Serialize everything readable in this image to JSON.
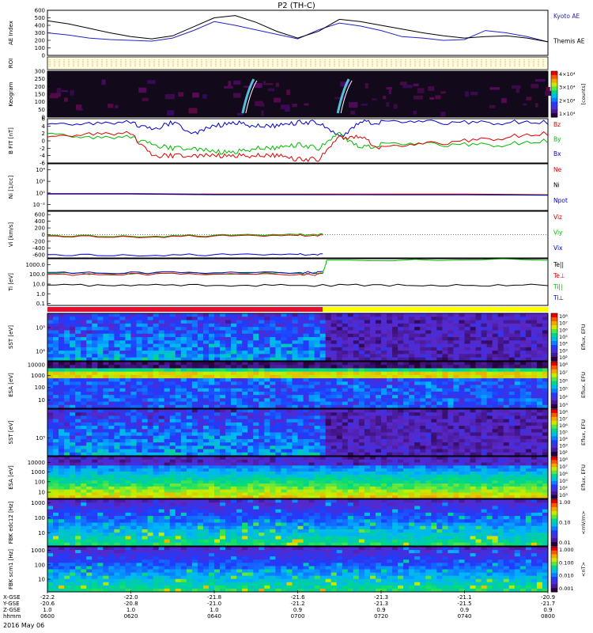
{
  "chart_data": {
    "type": "line",
    "title": "P2 (TH-C)",
    "date_label": "2016 May 06",
    "colors": {
      "kyoto": "#2222cc",
      "themis": "#000000",
      "red": "#dd0000",
      "green": "#00bb00",
      "blue": "#0000cc",
      "magenta": "#cc00cc",
      "bar_red": "#e01030",
      "bar_yellow": "#ffff00"
    },
    "panels": [
      {
        "id": "ae",
        "kind": "line",
        "ylabel": "AE Index",
        "ylim": [
          0,
          600
        ],
        "yticks": [
          {
            "v": 0,
            "t": "0"
          },
          {
            "v": 100,
            "t": "100"
          },
          {
            "v": 200,
            "t": "200"
          },
          {
            "v": 300,
            "t": "300"
          },
          {
            "v": 400,
            "t": "400"
          },
          {
            "v": 500,
            "t": "500"
          },
          {
            "v": 600,
            "t": "600"
          }
        ],
        "legend": [
          {
            "text": "Kyoto AE",
            "color": "#2222cc"
          },
          {
            "text": "Themis AE",
            "color": "#000000"
          }
        ],
        "series": [
          {
            "name": "Kyoto AE",
            "color": "#2222cc",
            "x": [
              0,
              5,
              10,
              15,
              20,
              25,
              30,
              35,
              40,
              45,
              50,
              55,
              60,
              65,
              70,
              75,
              80,
              85,
              90,
              95,
              100,
              105,
              110,
              115,
              120
            ],
            "y": [
              300,
              270,
              230,
              210,
              200,
              190,
              230,
              330,
              450,
              400,
              340,
              280,
              220,
              340,
              430,
              390,
              330,
              250,
              230,
              200,
              210,
              330,
              300,
              250,
              180
            ]
          },
          {
            "name": "Themis AE",
            "color": "#000000",
            "x": [
              0,
              5,
              10,
              15,
              20,
              25,
              30,
              35,
              40,
              45,
              50,
              55,
              60,
              65,
              70,
              75,
              80,
              85,
              90,
              95,
              100,
              105,
              110,
              115,
              120
            ],
            "y": [
              460,
              420,
              360,
              300,
              250,
              220,
              260,
              380,
              500,
              530,
              440,
              320,
              230,
              320,
              480,
              450,
              400,
              350,
              300,
              260,
              230,
              250,
              260,
              230,
              180
            ]
          }
        ]
      },
      {
        "id": "roi",
        "kind": "roi",
        "ylabel": "ROI"
      },
      {
        "id": "keogram",
        "kind": "image",
        "ylabel": "Keogram",
        "ylim": [
          0,
          300
        ],
        "yticks": [
          {
            "v": 0,
            "t": "0"
          },
          {
            "v": 50,
            "t": "50"
          },
          {
            "v": 100,
            "t": "100"
          },
          {
            "v": 150,
            "t": "150"
          },
          {
            "v": 200,
            "t": "200"
          },
          {
            "v": 250,
            "t": "250"
          },
          {
            "v": 300,
            "t": "300"
          }
        ],
        "colorbar": {
          "type": "rainbow",
          "labels": [
            "4×10⁴",
            "3×10⁴",
            "2×10⁴",
            "1×10⁴"
          ],
          "title": "[counts]"
        }
      },
      {
        "id": "bfield",
        "kind": "line",
        "ylabel": "B FIT [nT]",
        "ylim": [
          -6,
          6
        ],
        "yticks": [
          {
            "v": -6,
            "t": "-6"
          },
          {
            "v": -4,
            "t": "-4"
          },
          {
            "v": -2,
            "t": "-2"
          },
          {
            "v": 0,
            "t": "0"
          },
          {
            "v": 2,
            "t": "2"
          },
          {
            "v": 4,
            "t": "4"
          },
          {
            "v": 6,
            "t": "6"
          }
        ],
        "legend": [
          {
            "text": "Bz",
            "color": "#dd0000"
          },
          {
            "text": "By",
            "color": "#00bb00"
          },
          {
            "text": "Bx",
            "color": "#0000cc"
          }
        ],
        "series": [
          {
            "name": "Bx",
            "color": "#0000cc",
            "x": [
              0,
              10,
              20,
              25,
              30,
              35,
              40,
              45,
              50,
              55,
              60,
              65,
              70,
              75,
              80,
              90,
              100,
              110,
              120
            ],
            "y": [
              4.5,
              4.8,
              5,
              3,
              5,
              2,
              4,
              5,
              4,
              4,
              5,
              5,
              1,
              5,
              5,
              5,
              5,
              5,
              5
            ]
          },
          {
            "name": "By",
            "color": "#00bb00",
            "x": [
              0,
              10,
              20,
              25,
              30,
              35,
              40,
              45,
              50,
              55,
              60,
              65,
              70,
              75,
              80,
              90,
              100,
              110,
              120
            ],
            "y": [
              2,
              1,
              1,
              -1,
              -2,
              -2,
              -3,
              -3,
              -2,
              -2,
              -1,
              -2,
              2,
              -2,
              -1,
              -1,
              -1,
              -1,
              0
            ]
          },
          {
            "name": "Bz",
            "color": "#dd0000",
            "x": [
              0,
              10,
              20,
              25,
              30,
              35,
              40,
              45,
              50,
              55,
              60,
              65,
              70,
              75,
              80,
              90,
              100,
              110,
              120
            ],
            "y": [
              1,
              2,
              2,
              -4,
              -4,
              -4,
              -4,
              -4,
              -4,
              -4,
              -5,
              -5,
              1,
              1,
              -2,
              -1,
              0,
              1,
              2
            ]
          }
        ]
      },
      {
        "id": "density",
        "kind": "line",
        "ylabel": "Ni [1/cc]",
        "ylog": true,
        "ylim": [
          -3,
          5
        ],
        "yticks": [
          {
            "v": -2,
            "t": "10⁻²"
          },
          {
            "v": 0,
            "t": "10⁰"
          },
          {
            "v": 2,
            "t": "10²"
          },
          {
            "v": 4,
            "t": "10⁴"
          }
        ],
        "legend": [
          {
            "text": "Ne",
            "color": "#dd0000"
          },
          {
            "text": "Ni",
            "color": "#000000"
          },
          {
            "text": "Npot",
            "color": "#0000cc"
          }
        ],
        "series": [
          {
            "name": "Ne",
            "color": "#dd0000",
            "x": [
              0,
              20,
              40,
              60,
              80,
              100,
              120
            ],
            "y": [
              -0.1,
              -0.1,
              -0.2,
              -0.2,
              -0.2,
              -0.2,
              -0.3
            ]
          },
          {
            "name": "Ni",
            "color": "#000000",
            "x": [
              0,
              20,
              40,
              60,
              80,
              100,
              120
            ],
            "y": [
              -0.15,
              -0.15,
              -0.25,
              -0.25,
              -0.3,
              -0.3,
              -0.35
            ]
          },
          {
            "name": "Npot",
            "color": "#0000cc",
            "x": [
              0,
              20,
              40,
              60,
              80,
              100,
              120
            ],
            "y": [
              -0.2,
              -0.2,
              -0.3,
              -0.3,
              -0.3,
              -0.3,
              -0.4
            ]
          }
        ]
      },
      {
        "id": "velocity",
        "kind": "line",
        "ylabel": "Vi [km/s]",
        "ylim": [
          -700,
          700
        ],
        "yticks": [
          {
            "v": -600,
            "t": "-600"
          },
          {
            "v": -400,
            "t": "-400"
          },
          {
            "v": -200,
            "t": "-200"
          },
          {
            "v": 0,
            "t": "0"
          },
          {
            "v": 200,
            "t": "200"
          },
          {
            "v": 400,
            "t": "400"
          },
          {
            "v": 600,
            "t": "600"
          }
        ],
        "legend": [
          {
            "text": "Viz",
            "color": "#dd0000"
          },
          {
            "text": "Viy",
            "color": "#00bb00"
          },
          {
            "text": "Vix",
            "color": "#0000cc"
          }
        ],
        "series": [
          {
            "name": "Vix",
            "color": "#0000cc",
            "x": [
              0,
              20,
              40,
              60,
              66
            ],
            "y": [
              -600,
              -610,
              -600,
              -590,
              -590
            ]
          },
          {
            "name": "Viy",
            "color": "#00bb00",
            "x": [
              0,
              20,
              40,
              60,
              66
            ],
            "y": [
              -20,
              -40,
              -20,
              10,
              10
            ]
          },
          {
            "name": "Viz",
            "color": "#dd0000",
            "x": [
              0,
              20,
              40,
              60,
              66
            ],
            "y": [
              -40,
              -60,
              -40,
              -20,
              -20
            ]
          }
        ]
      },
      {
        "id": "temperature",
        "kind": "line",
        "ylabel": "Ti [eV]",
        "ylog": true,
        "ylim": [
          -1.2,
          3.6
        ],
        "yticks": [
          {
            "v": -1,
            "t": "0.1"
          },
          {
            "v": 0,
            "t": "1.0"
          },
          {
            "v": 1,
            "t": "10.0"
          },
          {
            "v": 2,
            "t": "100.0"
          },
          {
            "v": 3,
            "t": "1000.0"
          }
        ],
        "legend": [
          {
            "text": "Te||",
            "color": "#000000"
          },
          {
            "text": "Te⊥",
            "color": "#dd0000"
          },
          {
            "text": "Ti||",
            "color": "#00bb00"
          },
          {
            "text": "Ti⊥",
            "color": "#0000cc"
          }
        ],
        "series": [
          {
            "name": "Te||",
            "color": "#000000",
            "x": [
              0,
              20,
              40,
              60,
              80,
              100,
              120
            ],
            "y": [
              0.9,
              0.85,
              0.9,
              0.85,
              0.9,
              0.9,
              0.9
            ]
          },
          {
            "name": "Ti||",
            "color": "#00bb00",
            "x": [
              0,
              20,
              40,
              60,
              66,
              67,
              120
            ],
            "y": [
              2.1,
              2.05,
              2.1,
              2.1,
              2.1,
              3.5,
              3.5
            ]
          },
          {
            "name": "Ti⊥",
            "color": "#0000cc",
            "x": [
              0,
              20,
              40,
              60,
              66
            ],
            "y": [
              2.2,
              2.15,
              2.2,
              2.2,
              2.2
            ]
          },
          {
            "name": "Te⊥",
            "color": "#dd0000",
            "x": [
              0,
              20,
              40,
              60,
              66
            ],
            "y": [
              2.0,
              2.0,
              2.05,
              2.0,
              2.0
            ]
          }
        ]
      },
      {
        "id": "modebar",
        "kind": "modebar"
      },
      {
        "id": "sst1",
        "kind": "spectro",
        "seed": 11,
        "ylabel": "SST [eV]",
        "yticks": [
          {
            "f": 0.3,
            "t": "10⁵"
          },
          {
            "f": 0.8,
            "t": "10⁶"
          }
        ],
        "colorbar": {
          "type": "rainbow",
          "labels": [
            "10⁸",
            "10⁷",
            "10⁶",
            "10⁵",
            "10⁴",
            "10³",
            "10²"
          ],
          "title": "Eflux, EFU"
        }
      },
      {
        "id": "esa1",
        "kind": "spectro",
        "seed": 23,
        "ylabel": "ESA [eV]",
        "yticks": [
          {
            "f": 0.07,
            "t": "10000"
          },
          {
            "f": 0.3,
            "t": "1000"
          },
          {
            "f": 0.55,
            "t": "100"
          },
          {
            "f": 0.82,
            "t": "10"
          }
        ],
        "colorbar": {
          "type": "rainbow",
          "labels": [
            "10⁸",
            "10⁷",
            "10⁶",
            "10⁵",
            "10⁴",
            "10³"
          ],
          "title": "Eflux, EFU"
        }
      },
      {
        "id": "sst2",
        "kind": "spectro",
        "seed": 37,
        "ylabel": "SST [eV]",
        "yticks": [
          {
            "f": 0.62,
            "t": "10⁵"
          }
        ],
        "colorbar": {
          "type": "rainbow",
          "labels": [
            "10⁸",
            "10⁷",
            "10⁶",
            "10⁵",
            "10⁴",
            "10³",
            "10²"
          ],
          "title": "Eflux, EFU"
        }
      },
      {
        "id": "esa2",
        "kind": "spectro",
        "seed": 51,
        "ylabel": "ESA [eV]",
        "yticks": [
          {
            "f": 0.14,
            "t": "10000"
          },
          {
            "f": 0.37,
            "t": "1000"
          },
          {
            "f": 0.6,
            "t": "100"
          },
          {
            "f": 0.85,
            "t": "10"
          }
        ],
        "colorbar": {
          "type": "rainbow",
          "labels": [
            "10⁸",
            "10⁷",
            "10⁶",
            "10⁵",
            "10⁴",
            "10³"
          ],
          "title": "Eflux, EFU"
        }
      },
      {
        "id": "fbk1",
        "kind": "spectro",
        "seed": 67,
        "ylabel": "FBK edc12 [Hz]",
        "yticks": [
          {
            "f": 0.08,
            "t": "1000"
          },
          {
            "f": 0.4,
            "t": "100"
          },
          {
            "f": 0.72,
            "t": "10"
          }
        ],
        "colorbar": {
          "type": "rainbow",
          "labels": [
            "1.00",
            "0.10",
            "0.01"
          ],
          "title": "<mV/m>"
        }
      },
      {
        "id": "fbk2",
        "kind": "spectro",
        "seed": 79,
        "ylabel": "FBK scm1 [Hz]",
        "yticks": [
          {
            "f": 0.08,
            "t": "1000"
          },
          {
            "f": 0.4,
            "t": "100"
          },
          {
            "f": 0.72,
            "t": "10"
          }
        ],
        "colorbar": {
          "type": "rainbow",
          "labels": [
            "1.000",
            "0.100",
            "0.010",
            "0.001"
          ],
          "title": "<nT>"
        }
      }
    ],
    "xaxis": {
      "xlim": [
        0,
        120
      ],
      "row_labels": [
        "X-GSE",
        "Y-GSE",
        "Z-GSE",
        "hhmm"
      ],
      "ticks": [
        {
          "x": 0,
          "vals": [
            "-22.2",
            "-20.6",
            "1.0",
            "0600"
          ]
        },
        {
          "x": 20,
          "vals": [
            "-22.0",
            "-20.8",
            "1.0",
            "0620"
          ]
        },
        {
          "x": 40,
          "vals": [
            "-21.8",
            "-21.0",
            "1.0",
            "0640"
          ]
        },
        {
          "x": 60,
          "vals": [
            "-21.6",
            "-21.2",
            "0.9",
            "0700"
          ]
        },
        {
          "x": 80,
          "vals": [
            "-21.3",
            "-21.3",
            "0.9",
            "0720"
          ]
        },
        {
          "x": 100,
          "vals": [
            "-21.1",
            "-21.5",
            "0.9",
            "0740"
          ]
        },
        {
          "x": 120,
          "vals": [
            "-20.9",
            "-21.7",
            "0.9",
            "0800"
          ]
        }
      ]
    }
  }
}
